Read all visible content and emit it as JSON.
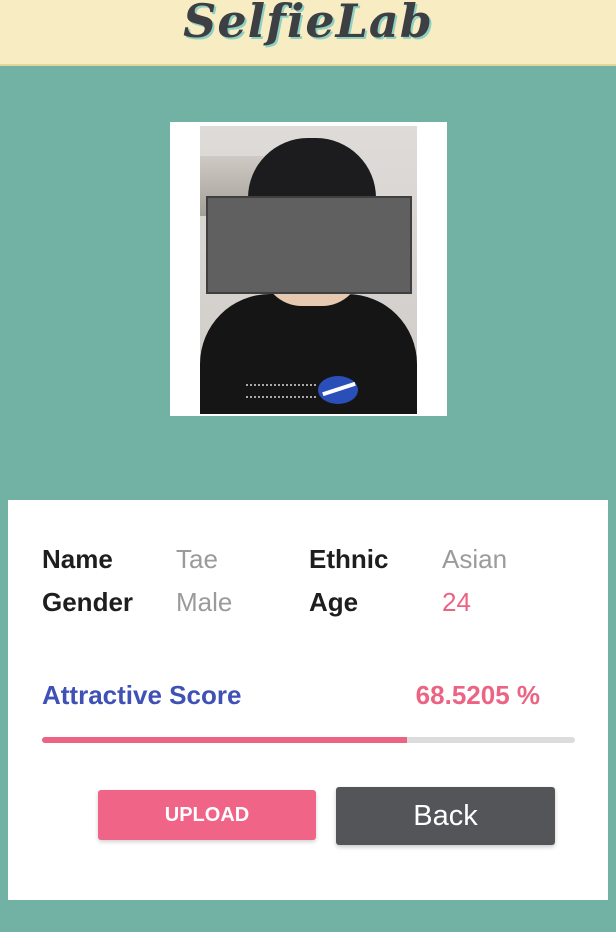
{
  "app": {
    "title": "SelfieLab"
  },
  "profile": {
    "name_label": "Name",
    "name_value": "Tae",
    "ethnic_label": "Ethnic",
    "ethnic_value": "Asian",
    "gender_label": "Gender",
    "gender_value": "Male",
    "age_label": "Age",
    "age_value": "24"
  },
  "score": {
    "label": "Attractive Score",
    "value_text": "68.5205 %",
    "progress_percent": 68.5205
  },
  "buttons": {
    "upload_label": "UPLOAD",
    "back_label": "Back"
  },
  "colors": {
    "background": "#72b2a4",
    "header": "#f8edc2",
    "accent_pink": "#ec6384",
    "score_blue": "#3f51b5",
    "back_button": "#535558"
  }
}
